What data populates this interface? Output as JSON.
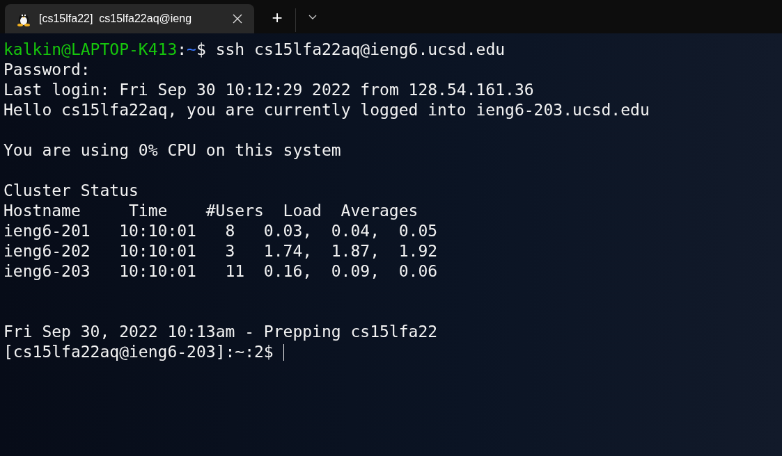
{
  "tabs": [
    {
      "title": "[cs15lfa22]  cs15lfa22aq@ieng",
      "selected": true
    }
  ],
  "new_tab_button": "+",
  "terminal": {
    "lines": [
      {
        "kind": "prompt",
        "user_host": "kalkin@LAPTOP-K413",
        "separator": ":",
        "path": "~",
        "command": "$ ssh cs15lfa22aq@ieng6.ucsd.edu"
      },
      {
        "kind": "text",
        "text": "Password:"
      },
      {
        "kind": "text",
        "text": "Last login: Fri Sep 30 10:12:29 2022 from 128.54.161.36"
      },
      {
        "kind": "text",
        "text": "Hello cs15lfa22aq, you are currently logged into ieng6-203.ucsd.edu"
      },
      {
        "kind": "blank"
      },
      {
        "kind": "text",
        "text": "You are using 0% CPU on this system"
      },
      {
        "kind": "blank"
      },
      {
        "kind": "text",
        "text": "Cluster Status"
      },
      {
        "kind": "table_header",
        "cells": [
          "Hostname",
          "Time",
          "#Users",
          "Load",
          "Averages"
        ]
      },
      {
        "kind": "table_row",
        "cells": [
          "ieng6-201",
          "10:10:01",
          "8",
          "0.03,",
          "0.04,",
          "0.05"
        ]
      },
      {
        "kind": "table_row",
        "cells": [
          "ieng6-202",
          "10:10:01",
          "3",
          "1.74,",
          "1.87,",
          "1.92"
        ]
      },
      {
        "kind": "table_row",
        "cells": [
          "ieng6-203",
          "10:10:01",
          "11",
          "0.16,",
          "0.09,",
          "0.06"
        ]
      },
      {
        "kind": "blank"
      },
      {
        "kind": "blank"
      },
      {
        "kind": "text",
        "text": "Fri Sep 30, 2022 10:13am - Prepping cs15lfa22"
      },
      {
        "kind": "input",
        "text": "[cs15lfa22aq@ieng6-203]:~:2$ "
      }
    ]
  }
}
